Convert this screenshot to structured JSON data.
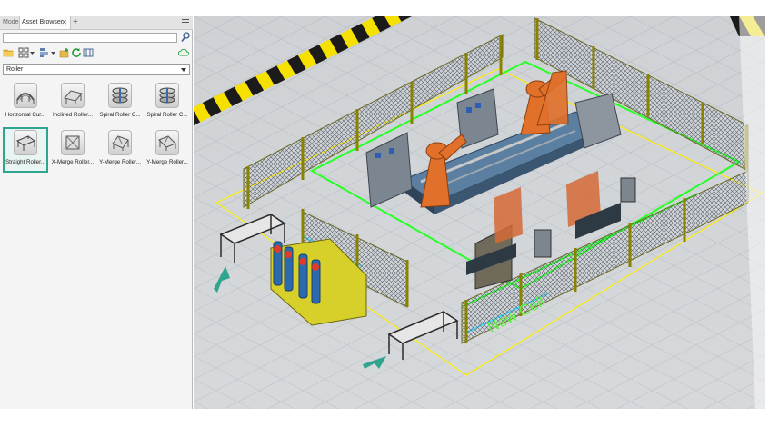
{
  "tabs": {
    "model": "Model",
    "asset_browser": "Asset Browser",
    "close": "✕",
    "add": "+"
  },
  "search": {
    "value": "",
    "placeholder": ""
  },
  "toolbar_icons": [
    "folder-icon",
    "grid-view-icon",
    "dropdown-icon",
    "sort-icon",
    "dropdown-icon",
    "add-asset-icon",
    "refresh-icon",
    "library-icon",
    "cloud-icon"
  ],
  "category": {
    "selected": "Roller"
  },
  "assets": [
    {
      "label": "Horizontal Cur...",
      "icon": "horizontal-curve-roller-icon",
      "selected": false
    },
    {
      "label": "Inclined Roller...",
      "icon": "inclined-roller-icon",
      "selected": false
    },
    {
      "label": "Spiral Roller C...",
      "icon": "spiral-roller-icon",
      "selected": false
    },
    {
      "label": "Spiral Roller C...",
      "icon": "spiral-roller-icon",
      "selected": false
    },
    {
      "label": "Straight Roller...",
      "icon": "straight-roller-icon",
      "selected": true
    },
    {
      "label": "X-Merge Roller...",
      "icon": "x-merge-roller-icon",
      "selected": false
    },
    {
      "label": "Y-Merge Roller...",
      "icon": "y-merge-roller-icon",
      "selected": false
    },
    {
      "label": "Y-Merge Roller...",
      "icon": "y-merge-roller-icon",
      "selected": false
    }
  ],
  "viewport": {
    "cell_label": "New Cell",
    "accent": "#2fa58f",
    "cell_outline": "#ffff00",
    "floor_marking": "#00ff00"
  }
}
